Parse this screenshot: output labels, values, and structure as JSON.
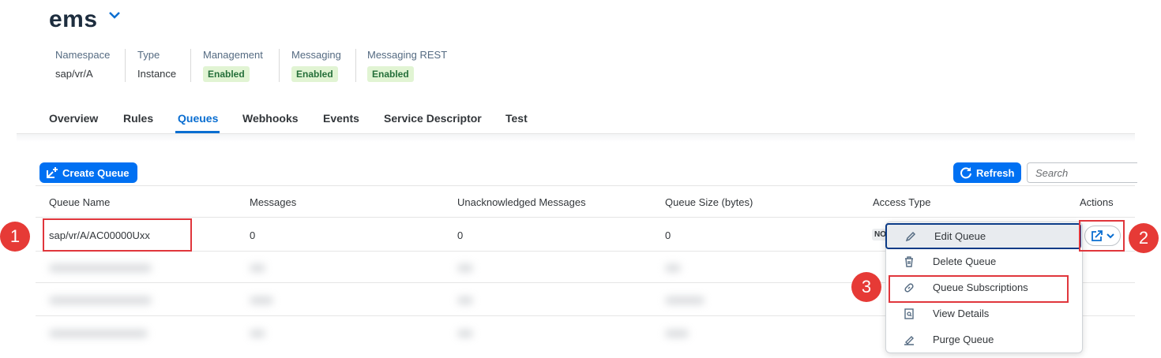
{
  "header": {
    "title": "ems",
    "attributes": [
      {
        "label": "Namespace",
        "value": "sap/vr/A"
      },
      {
        "label": "Type",
        "value": "Instance"
      },
      {
        "label": "Management",
        "value": "Enabled"
      },
      {
        "label": "Messaging",
        "value": "Enabled"
      },
      {
        "label": "Messaging REST",
        "value": "Enabled"
      }
    ]
  },
  "tabs": [
    {
      "label": "Overview"
    },
    {
      "label": "Rules"
    },
    {
      "label": "Queues",
      "active": true
    },
    {
      "label": "Webhooks"
    },
    {
      "label": "Events"
    },
    {
      "label": "Service Descriptor"
    },
    {
      "label": "Test"
    }
  ],
  "toolbar": {
    "create_label": "Create Queue",
    "refresh_label": "Refresh",
    "search_placeholder": "Search"
  },
  "table": {
    "columns": [
      "Queue Name",
      "Messages",
      "Unacknowledged Messages",
      "Queue Size (bytes)",
      "Access Type",
      "Actions"
    ],
    "rows": [
      {
        "name": "sap/vr/A/AC00000Uxx",
        "messages": "0",
        "unacked": "0",
        "size": "0",
        "access": "NO"
      }
    ]
  },
  "menu": {
    "items": [
      {
        "label": "Edit Queue",
        "icon": "pencil-icon"
      },
      {
        "label": "Delete Queue",
        "icon": "trash-icon"
      },
      {
        "label": "Queue Subscriptions",
        "icon": "link-icon"
      },
      {
        "label": "View Details",
        "icon": "details-icon"
      },
      {
        "label": "Purge Queue",
        "icon": "eraser-icon"
      }
    ]
  },
  "callouts": [
    "1",
    "2",
    "3"
  ],
  "colors": {
    "accent": "#0a6ed1",
    "button": "#0070f2",
    "callout": "#e63a36",
    "badge_bg": "#e1f4d3"
  }
}
